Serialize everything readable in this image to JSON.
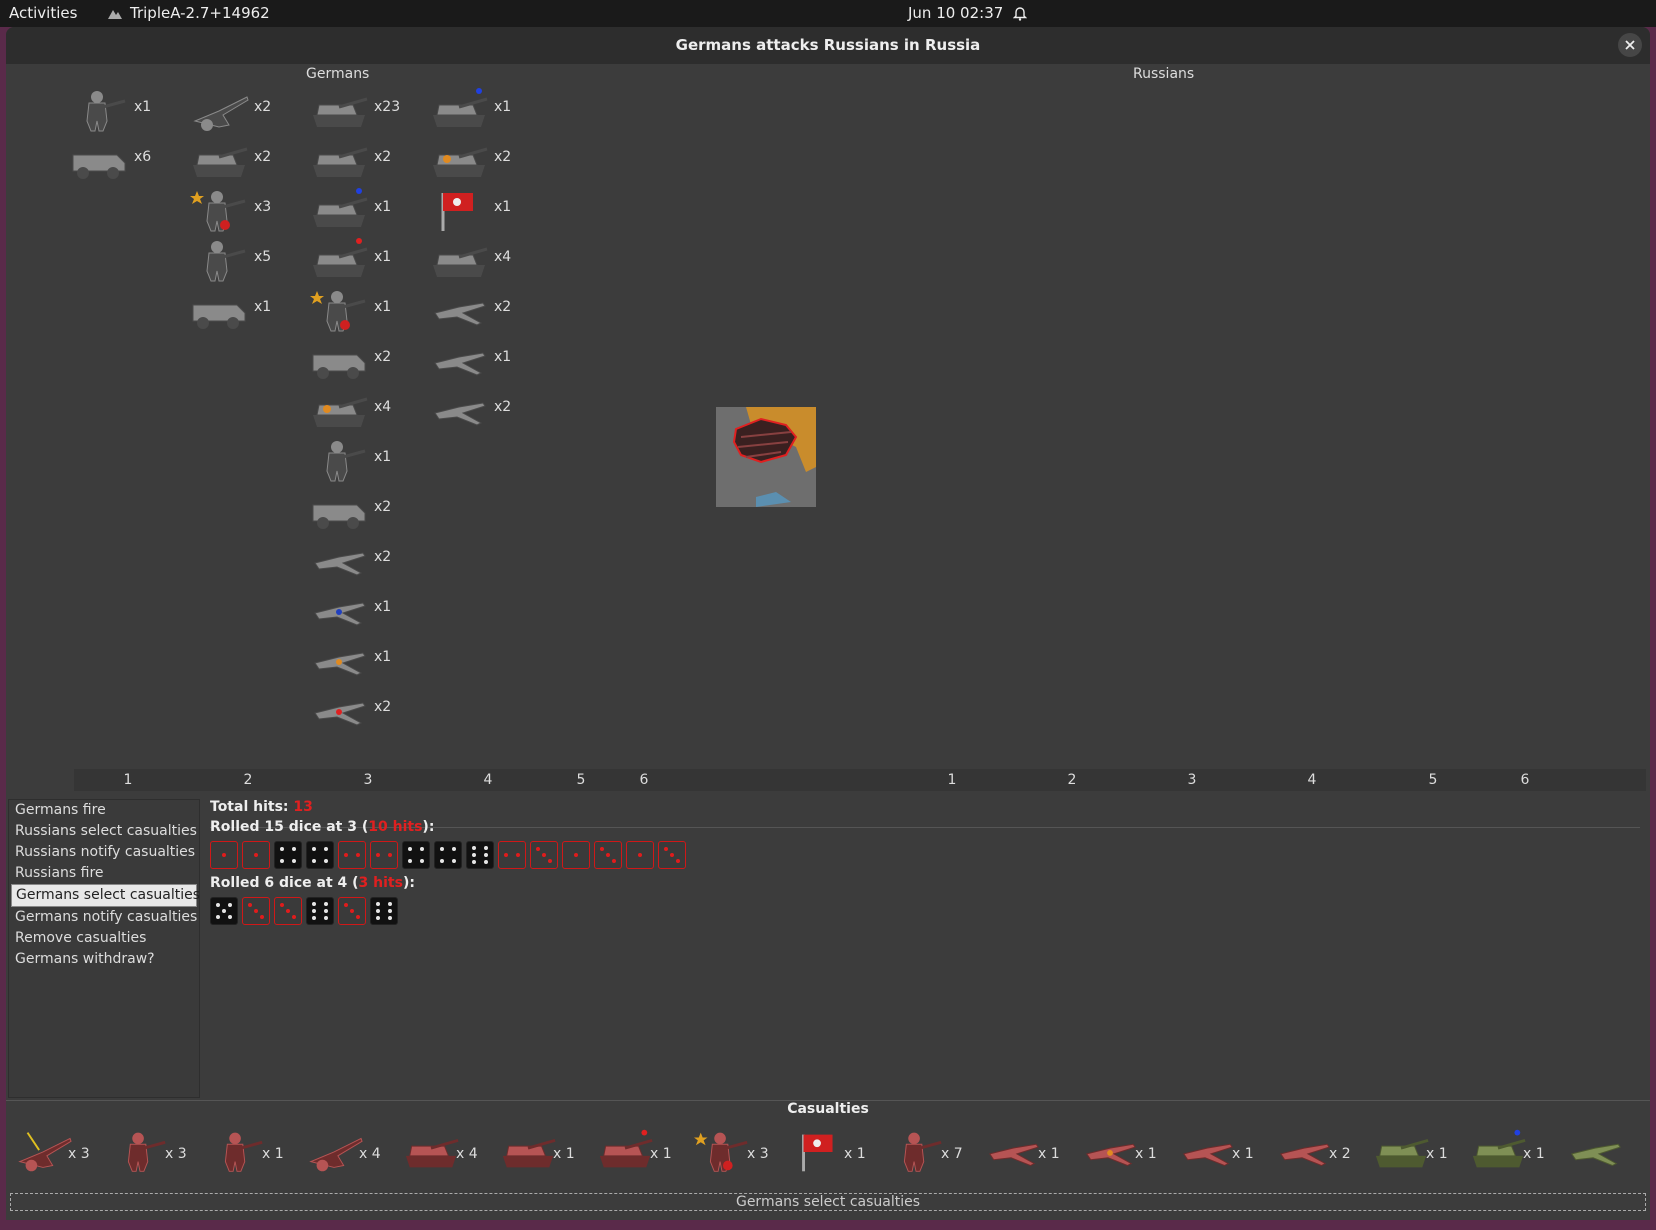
{
  "topbar": {
    "activities": "Activities",
    "app_title": "TripleA-2.7+14962",
    "datetime": "Jun 10  02:37"
  },
  "window": {
    "title": "Germans attacks Russians in Russia"
  },
  "battle": {
    "attacker_label": "Germans",
    "defender_label": "Russians",
    "attacker_units": [
      {
        "col": 1,
        "row": 0,
        "count": "x1",
        "icon": "infantry-icon"
      },
      {
        "col": 1,
        "row": 1,
        "count": "x6",
        "icon": "armored-car-icon"
      },
      {
        "col": 2,
        "row": 0,
        "count": "x2",
        "icon": "artillery-icon"
      },
      {
        "col": 2,
        "row": 1,
        "count": "x2",
        "icon": "tank-destroyer-icon"
      },
      {
        "col": 2,
        "row": 2,
        "count": "x3",
        "icon": "officer-icon"
      },
      {
        "col": 2,
        "row": 3,
        "count": "x5",
        "icon": "mountain-infantry-icon"
      },
      {
        "col": 2,
        "row": 4,
        "count": "x1",
        "icon": "halftrack-icon"
      },
      {
        "col": 3,
        "row": 0,
        "count": "x23",
        "icon": "assault-gun-icon"
      },
      {
        "col": 3,
        "row": 1,
        "count": "x2",
        "icon": "light-tank-icon"
      },
      {
        "col": 3,
        "row": 2,
        "count": "x1",
        "icon": "heavy-tank-blue-icon"
      },
      {
        "col": 3,
        "row": 3,
        "count": "x1",
        "icon": "heavy-tank-red-icon"
      },
      {
        "col": 3,
        "row": 4,
        "count": "x1",
        "icon": "officer-icon"
      },
      {
        "col": 3,
        "row": 5,
        "count": "x2",
        "icon": "scout-car-icon"
      },
      {
        "col": 3,
        "row": 6,
        "count": "x4",
        "icon": "burning-tank-icon"
      },
      {
        "col": 3,
        "row": 7,
        "count": "x1",
        "icon": "infantry-icon"
      },
      {
        "col": 3,
        "row": 8,
        "count": "x2",
        "icon": "halftrack-icon"
      },
      {
        "col": 3,
        "row": 9,
        "count": "x2",
        "icon": "fighter-icon"
      },
      {
        "col": 3,
        "row": 10,
        "count": "x1",
        "icon": "fighter-blue-icon"
      },
      {
        "col": 3,
        "row": 11,
        "count": "x1",
        "icon": "fighter-orange-icon"
      },
      {
        "col": 3,
        "row": 12,
        "count": "x2",
        "icon": "fighter-red-icon"
      },
      {
        "col": 4,
        "row": 0,
        "count": "x1",
        "icon": "tank-blue-icon"
      },
      {
        "col": 4,
        "row": 1,
        "count": "x2",
        "icon": "damaged-tank-icon"
      },
      {
        "col": 4,
        "row": 2,
        "count": "x1",
        "icon": "flag-icon"
      },
      {
        "col": 4,
        "row": 3,
        "count": "x4",
        "icon": "tank-icon"
      },
      {
        "col": 4,
        "row": 4,
        "count": "x2",
        "icon": "fighter-icon"
      },
      {
        "col": 4,
        "row": 5,
        "count": "x1",
        "icon": "bomber-icon"
      },
      {
        "col": 4,
        "row": 6,
        "count": "x2",
        "icon": "dive-bomber-icon"
      }
    ],
    "attacker_columns": [
      "1",
      "2",
      "3",
      "4",
      "5",
      "6"
    ],
    "defender_columns": [
      "1",
      "2",
      "3",
      "4",
      "5",
      "6"
    ]
  },
  "steps": [
    "Germans fire",
    "Russians select casualties",
    "Russians notify casualties",
    "Russians fire",
    "Germans select casualties",
    "Germans notify casualties",
    "Remove casualties",
    "Germans withdraw?"
  ],
  "selected_step_index": 4,
  "results": {
    "total_label": "Total hits: ",
    "total_value": "13",
    "roll1_prefix": "Rolled 15 dice at 3 (",
    "roll1_hits": "10 hits",
    "roll1_suffix": "):",
    "roll1_dice": [
      1,
      1,
      4,
      4,
      2,
      2,
      4,
      4,
      6,
      2,
      3,
      1,
      3,
      1,
      3
    ],
    "roll1_hit": [
      true,
      true,
      false,
      false,
      true,
      true,
      false,
      false,
      false,
      true,
      true,
      true,
      true,
      true,
      true
    ],
    "roll2_prefix": "Rolled 6 dice at 4 (",
    "roll2_hits": "3 hits",
    "roll2_suffix": "):",
    "roll2_dice": [
      5,
      3,
      3,
      6,
      3,
      6
    ],
    "roll2_hit": [
      false,
      true,
      true,
      false,
      true,
      false
    ]
  },
  "casualties": {
    "title": "Casualties",
    "items": [
      {
        "count": "x 3",
        "icon": "anti-air-gun-icon"
      },
      {
        "count": "x 3",
        "icon": "infantry-icon"
      },
      {
        "count": "x 1",
        "icon": "infantry-icon"
      },
      {
        "count": "x 4",
        "icon": "artillery-icon"
      },
      {
        "count": "x 4",
        "icon": "tank-icon"
      },
      {
        "count": "x 1",
        "icon": "tank-destroyer-icon"
      },
      {
        "count": "x 1",
        "icon": "tank-red-dot-icon"
      },
      {
        "count": "x 3",
        "icon": "officer-icon"
      },
      {
        "count": "x 1",
        "icon": "flag-icon"
      },
      {
        "count": "x 7",
        "icon": "infantry-icon"
      },
      {
        "count": "x 1",
        "icon": "fighter-icon"
      },
      {
        "count": "x 1",
        "icon": "fighter-orange-icon"
      },
      {
        "count": "x 1",
        "icon": "fighter-icon"
      },
      {
        "count": "x 2",
        "icon": "fighter-icon"
      },
      {
        "count": "x 1",
        "icon": "green-tank-icon"
      },
      {
        "count": "x 1",
        "icon": "green-tank-blue-icon"
      },
      {
        "count": "",
        "icon": "green-fighter-icon"
      }
    ]
  },
  "statusbar": {
    "text": "Germans select  casualties"
  },
  "colors": {
    "window_bg": "#3c3c3c",
    "hit_red": "#e02020",
    "soviet_red": "#b04848",
    "german_gray": "#8a8a8a"
  }
}
